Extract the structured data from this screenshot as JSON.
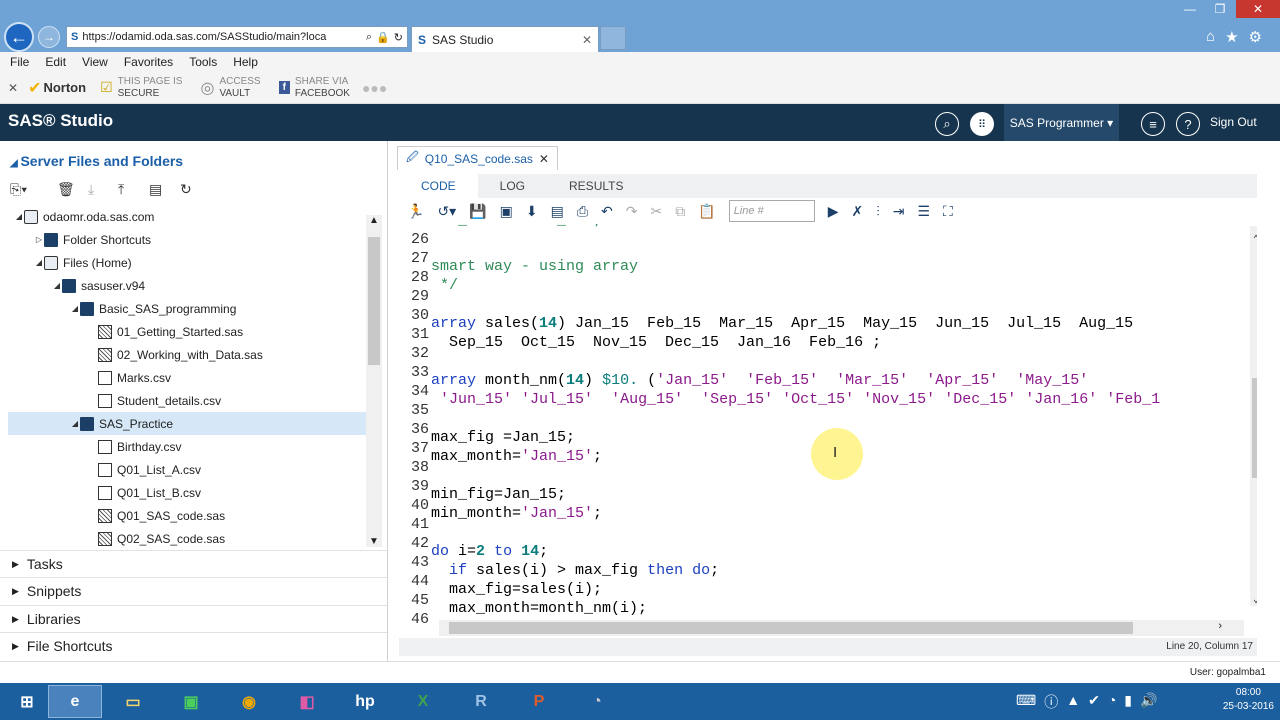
{
  "browser": {
    "url": "https://odamid.oda.sas.com/SASStudio/main?loca",
    "tab_title": "SAS Studio",
    "menu": [
      "File",
      "Edit",
      "View",
      "Favorites",
      "Tools",
      "Help"
    ],
    "fav": {
      "norton": "Norton",
      "secure1": "THIS PAGE IS",
      "secure2": "SECURE",
      "vault1": "ACCESS",
      "vault2": "VAULT",
      "share1": "SHARE VIA",
      "share2": "FACEBOOK"
    }
  },
  "sas": {
    "title": "SAS® Studio",
    "role": "SAS Programmer ▾",
    "signout": "Sign Out"
  },
  "left": {
    "title": "Server Files and Folders",
    "tree": [
      {
        "label": "odaomr.oda.sas.com",
        "tri": "◢",
        "icon": "server"
      },
      {
        "label": "Folder Shortcuts",
        "tri": "▷",
        "icon": "folder"
      },
      {
        "label": "Files (Home)",
        "tri": "◢",
        "icon": "server"
      },
      {
        "label": "sasuser.v94",
        "tri": "◢",
        "icon": "folder"
      },
      {
        "label": "Basic_SAS_programming",
        "tri": "◢",
        "icon": "folder"
      },
      {
        "label": "01_Getting_Started.sas",
        "tri": "",
        "icon": "sasfile"
      },
      {
        "label": "02_Working_with_Data.sas",
        "tri": "",
        "icon": "sasfile"
      },
      {
        "label": "Marks.csv",
        "tri": "",
        "icon": "file"
      },
      {
        "label": "Student_details.csv",
        "tri": "",
        "icon": "file"
      },
      {
        "label": "SAS_Practice",
        "tri": "◢",
        "icon": "folder"
      },
      {
        "label": "Birthday.csv",
        "tri": "",
        "icon": "file"
      },
      {
        "label": "Q01_List_A.csv",
        "tri": "",
        "icon": "file"
      },
      {
        "label": "Q01_List_B.csv",
        "tri": "",
        "icon": "file"
      },
      {
        "label": "Q01_SAS_code.sas",
        "tri": "",
        "icon": "sasfile"
      },
      {
        "label": "Q02_SAS_code.sas",
        "tri": "",
        "icon": "sasfile"
      }
    ],
    "sections": [
      "Tasks",
      "Snippets",
      "Libraries",
      "File Shortcuts"
    ]
  },
  "editor": {
    "file_tab": "Q10_SAS_code.sas",
    "tabs": [
      "CODE",
      "LOG",
      "RESULTS"
    ],
    "line_placeholder": "Line #",
    "line_numbers": [
      "26",
      "27",
      "28",
      "29",
      "30",
      "31",
      "32",
      "33",
      "34",
      "35",
      "36",
      "37",
      "38",
      "39",
      "40",
      "41",
      "42",
      "43",
      "44",
      "45",
      "46"
    ],
    "status": "Line 20, Column 17",
    "user": "User: gopalmba1"
  },
  "taskbar": {
    "time": "08:00",
    "date": "25-03-2016"
  }
}
